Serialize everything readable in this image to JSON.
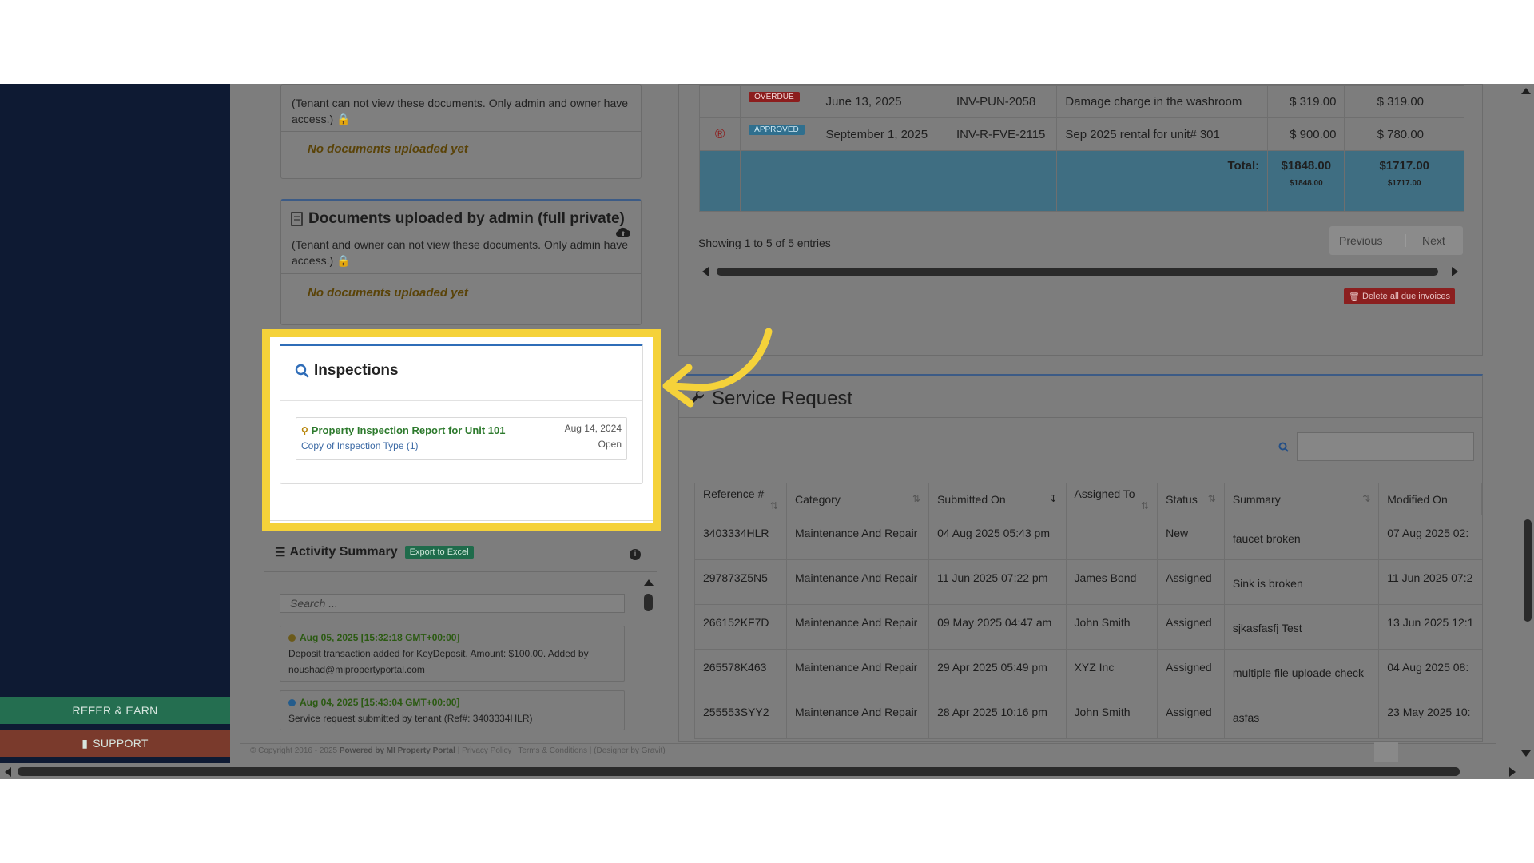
{
  "sidebar": {
    "refer_label": "REFER & EARN",
    "support_label": "SUPPORT"
  },
  "docs_a": {
    "note": "(Tenant can not view these documents. Only admin and owner have access.) 🔒",
    "empty": "No documents uploaded yet"
  },
  "docs_b": {
    "title": "Documents uploaded by admin (full private)",
    "note": "(Tenant and owner can not view these documents. Only admin have access.) 🔒",
    "empty": "No documents uploaded yet"
  },
  "inspections": {
    "title": "Inspections",
    "item_title": "Property Inspection Report for Unit 101",
    "item_sub": "Copy of Inspection Type (1)",
    "item_date": "Aug 14, 2024",
    "item_status": "Open"
  },
  "activity": {
    "title": "Activity Summary",
    "export_label": "Export to Excel",
    "search_placeholder": "Search ...",
    "items": [
      {
        "date": "Aug 05, 2025 [15:32:18 GMT+00:00]",
        "text": "Deposit transaction added for KeyDeposit. Amount: $100.00. Added by noushad@mipropertyportal.com",
        "dot_color": "#6b5a1a"
      },
      {
        "date": "Aug 04, 2025 [15:43:04 GMT+00:00]",
        "text": "Service request submitted by tenant (Ref#: 3403334HLR)",
        "dot_color": "#245c8c"
      }
    ]
  },
  "invoices": {
    "rows": [
      {
        "badge": "OVERDUE",
        "date": "June 13, 2025",
        "number": "INV-PUN-2058",
        "desc": "Damage charge in the washroom",
        "amount": "$ 319.00",
        "due": "$ 319.00",
        "flag": ""
      },
      {
        "badge": "APPROVED",
        "date": "September 1, 2025",
        "number": "INV-R-FVE-2115",
        "desc": "Sep 2025 rental for unit# 301",
        "amount": "$ 900.00",
        "due": "$ 780.00",
        "flag": "®"
      }
    ],
    "total_label": "Total:",
    "total_amount": "$1848.00",
    "total_amount_small": "$1848.00",
    "total_due": "$1717.00",
    "total_due_small": "$1717.00",
    "showing": "Showing 1 to 5 of 5 entries",
    "prev_label": "Previous",
    "next_label": "Next",
    "delete_label": "Delete all due invoices"
  },
  "service_request": {
    "title": "Service Request",
    "columns": [
      "Reference #",
      "Category",
      "Submitted On",
      "Assigned To",
      "Status",
      "Summary",
      "Modified On"
    ],
    "rows": [
      {
        "ref": "3403334HLR",
        "category": "Maintenance And Repair",
        "submitted": "04 Aug 2025 05:43 pm",
        "assigned": "",
        "status": "New",
        "summary": "faucet broken",
        "modified": "07 Aug 2025 02:"
      },
      {
        "ref": "297873Z5N5",
        "category": "Maintenance And Repair",
        "submitted": "11 Jun 2025 07:22 pm",
        "assigned": "James Bond",
        "status": "Assigned",
        "summary": "Sink is broken",
        "modified": "11 Jun 2025 07:2"
      },
      {
        "ref": "266152KF7D",
        "category": "Maintenance And Repair",
        "submitted": "09 May 2025 04:47 am",
        "assigned": "John Smith",
        "status": "Assigned",
        "summary": "sjkasfasfj Test",
        "modified": "13 Jun 2025 12:1"
      },
      {
        "ref": "265578K463",
        "category": "Maintenance And Repair",
        "submitted": "29 Apr 2025 05:49 pm",
        "assigned": "XYZ Inc",
        "status": "Assigned",
        "summary": "multiple file uploade check",
        "modified": "04 Aug 2025 08:"
      },
      {
        "ref": "255553SYY2",
        "category": "Maintenance And Repair",
        "submitted": "28 Apr 2025 10:16 pm",
        "assigned": "John Smith",
        "status": "Assigned",
        "summary": "asfas",
        "modified": "23 May 2025 10:"
      }
    ]
  },
  "footer": {
    "copyright": "© Copyright 2016 - 2025",
    "powered": "Powered by MI Property Portal",
    "privacy": "Privacy Policy",
    "terms": "Terms & Conditions",
    "designer": "(Designer by Gravit)"
  },
  "colors": {
    "highlight": "#f5d23a",
    "arrow": "#f5d23a",
    "overlay": "#7d7d7d"
  }
}
